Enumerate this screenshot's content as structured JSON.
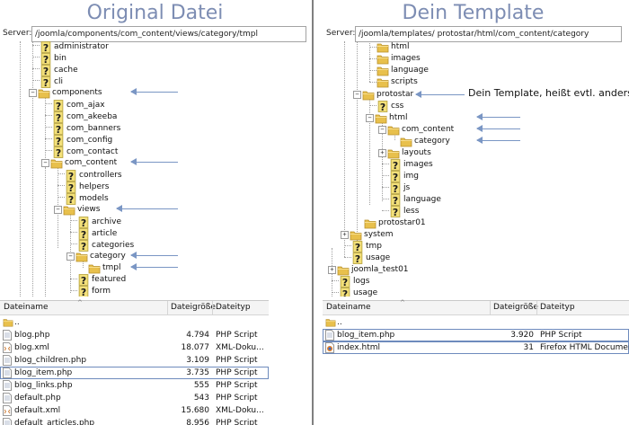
{
  "left": {
    "title": "Original Datei",
    "server_label": "Server:",
    "server_path": "/joomla/components/com_content/views/category/tmpl",
    "tree": {
      "administrator": "administrator",
      "bin": "bin",
      "cache": "cache",
      "cli": "cli",
      "components": "components",
      "com_ajax": "com_ajax",
      "com_akeeba": "com_akeeba",
      "com_banners": "com_banners",
      "com_config": "com_config",
      "com_contact": "com_contact",
      "com_content": "com_content",
      "controllers": "controllers",
      "helpers": "helpers",
      "models": "models",
      "views": "views",
      "archive": "archive",
      "article": "article",
      "categories": "categories",
      "category": "category",
      "tmpl": "tmpl",
      "featured": "featured",
      "form": "form"
    },
    "columns": {
      "name": "Dateiname",
      "size": "Dateigröße",
      "type": "Dateityp"
    },
    "parent_dir": "..",
    "files": [
      {
        "name": "blog.php",
        "size": "4.794",
        "type": "PHP Script",
        "icon": "php-file-icon"
      },
      {
        "name": "blog.xml",
        "size": "18.077",
        "type": "XML-Doku...",
        "icon": "xml-file-icon"
      },
      {
        "name": "blog_children.php",
        "size": "3.109",
        "type": "PHP Script",
        "icon": "php-file-icon"
      },
      {
        "name": "blog_item.php",
        "size": "3.735",
        "type": "PHP Script",
        "icon": "php-file-icon"
      },
      {
        "name": "blog_links.php",
        "size": "555",
        "type": "PHP Script",
        "icon": "php-file-icon"
      },
      {
        "name": "default.php",
        "size": "543",
        "type": "PHP Script",
        "icon": "php-file-icon"
      },
      {
        "name": "default.xml",
        "size": "15.680",
        "type": "XML-Doku...",
        "icon": "xml-file-icon"
      },
      {
        "name": "default_articles.php",
        "size": "8.956",
        "type": "PHP Script",
        "icon": "php-file-icon"
      }
    ]
  },
  "right": {
    "title": "Dein Template",
    "server_label": "Server:",
    "server_path": "/joomla/templates/ protostar/html/com_content/category",
    "annotation": "Dein Template, heißt evtl. anders",
    "tree": {
      "html_top": "html",
      "images_top": "images",
      "language_top": "language",
      "scripts": "scripts",
      "protostar": "protostar",
      "css": "css",
      "html": "html",
      "com_content": "com_content",
      "category": "category",
      "layouts": "layouts",
      "images": "images",
      "img": "img",
      "js": "js",
      "language": "language",
      "less": "less",
      "protostar01": "protostar01",
      "system": "system",
      "tmp": "tmp",
      "usage": "usage",
      "joomla_test01": "joomla_test01",
      "logs": "logs",
      "usage2": "usage"
    },
    "columns": {
      "name": "Dateiname",
      "size": "Dateigröße",
      "type": "Dateityp"
    },
    "parent_dir": "..",
    "files": [
      {
        "name": "blog_item.php",
        "size": "3.920",
        "type": "PHP Script",
        "icon": "php-file-icon"
      },
      {
        "name": "index.html",
        "size": "31",
        "type": "Firefox HTML Document",
        "icon": "html-file-icon"
      }
    ]
  },
  "colors": {
    "title": "#7d8db3",
    "arrow": "#7a96c4",
    "folder": "#e8c04c",
    "highlight": "#6e8bbd"
  }
}
